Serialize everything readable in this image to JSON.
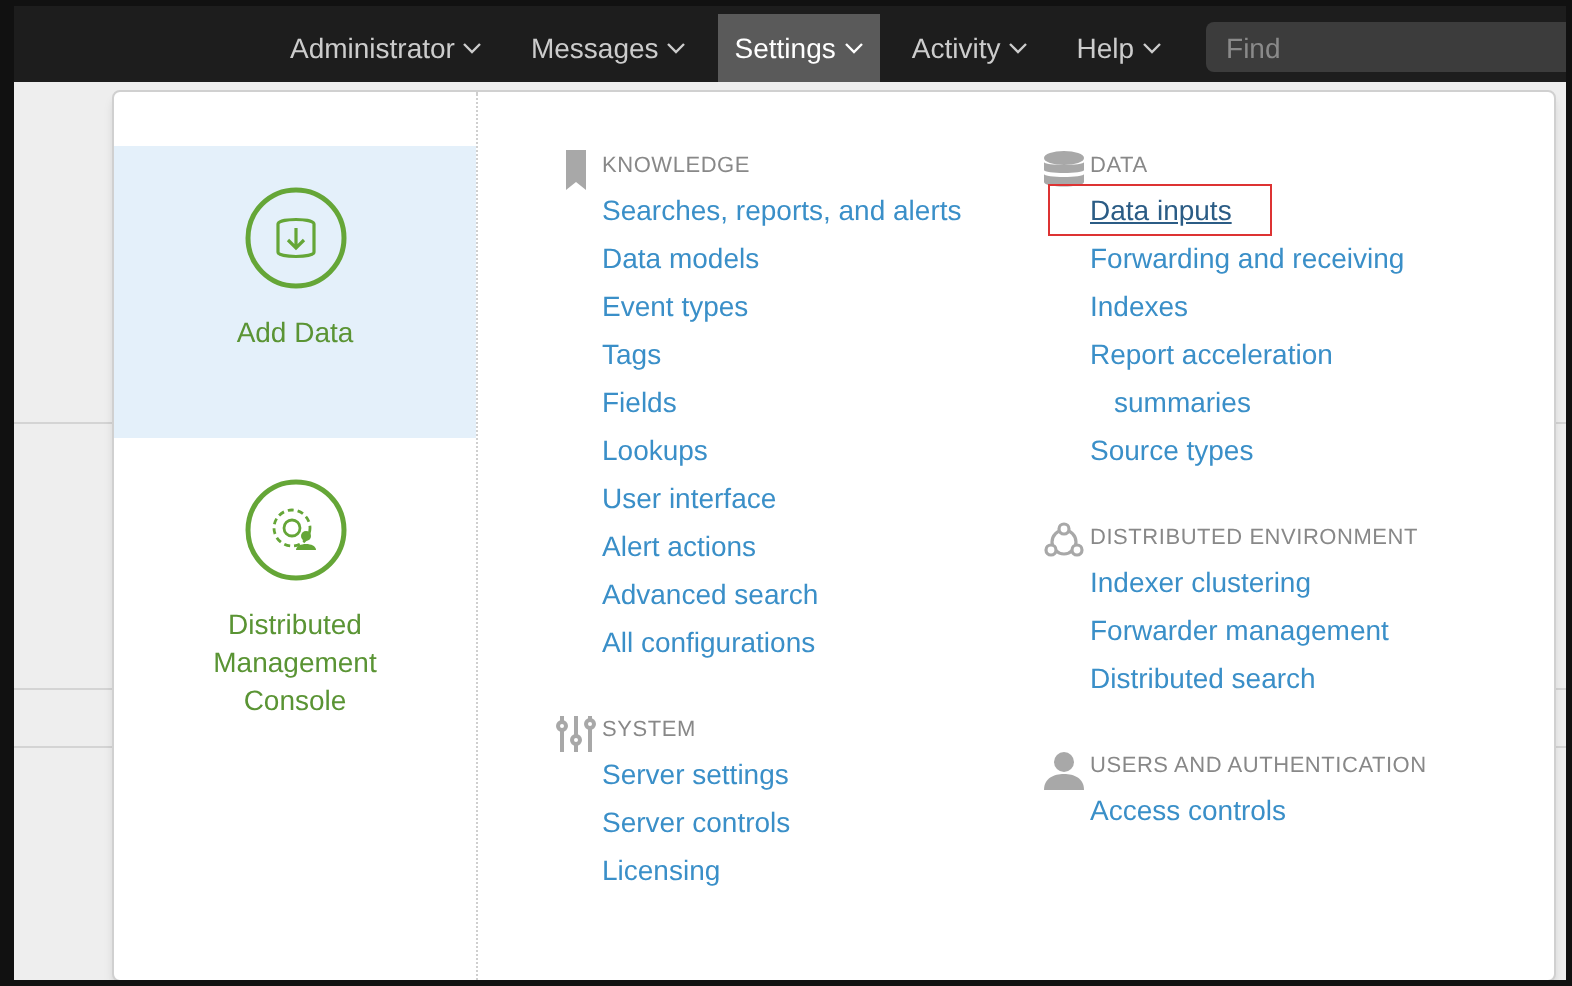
{
  "nav": [
    {
      "label": "Administrator",
      "selected": false
    },
    {
      "label": "Messages",
      "selected": false
    },
    {
      "label": "Settings",
      "selected": true
    },
    {
      "label": "Activity",
      "selected": false
    },
    {
      "label": "Help",
      "selected": false
    }
  ],
  "search": {
    "placeholder": "Find"
  },
  "tiles": [
    {
      "kind": "add-data",
      "label": "Add Data",
      "selected": true
    },
    {
      "kind": "console",
      "label": "Distributed Management Console",
      "selected": false
    }
  ],
  "columns": [
    [
      {
        "kind": "bookmark",
        "title": "KNOWLEDGE",
        "links": [
          {
            "label": "Searches, reports, and alerts",
            "highlighted": false
          },
          {
            "label": "Data models",
            "highlighted": false
          },
          {
            "label": "Event types",
            "highlighted": false
          },
          {
            "label": "Tags",
            "highlighted": false
          },
          {
            "label": "Fields",
            "highlighted": false
          },
          {
            "label": "Lookups",
            "highlighted": false
          },
          {
            "label": "User interface",
            "highlighted": false
          },
          {
            "label": "Alert actions",
            "highlighted": false
          },
          {
            "label": "Advanced search",
            "highlighted": false
          },
          {
            "label": "All configurations",
            "highlighted": false
          }
        ]
      },
      {
        "kind": "sliders",
        "title": "SYSTEM",
        "links": [
          {
            "label": "Server settings",
            "highlighted": false
          },
          {
            "label": "Server controls",
            "highlighted": false
          },
          {
            "label": "Licensing",
            "highlighted": false
          }
        ]
      }
    ],
    [
      {
        "kind": "database",
        "title": "DATA",
        "links": [
          {
            "label": "Data inputs",
            "highlighted": true
          },
          {
            "label": "Forwarding and receiving",
            "highlighted": false
          },
          {
            "label": "Indexes",
            "highlighted": false
          },
          {
            "label": "Report acceleration summaries",
            "highlighted": false
          },
          {
            "label": "Source types",
            "highlighted": false
          }
        ]
      },
      {
        "kind": "network",
        "title": "DISTRIBUTED ENVIRONMENT",
        "links": [
          {
            "label": "Indexer clustering",
            "highlighted": false
          },
          {
            "label": "Forwarder management",
            "highlighted": false
          },
          {
            "label": "Distributed search",
            "highlighted": false
          }
        ]
      },
      {
        "kind": "user",
        "title": "USERS AND AUTHENTICATION",
        "links": [
          {
            "label": "Access controls",
            "highlighted": false
          }
        ]
      }
    ]
  ]
}
